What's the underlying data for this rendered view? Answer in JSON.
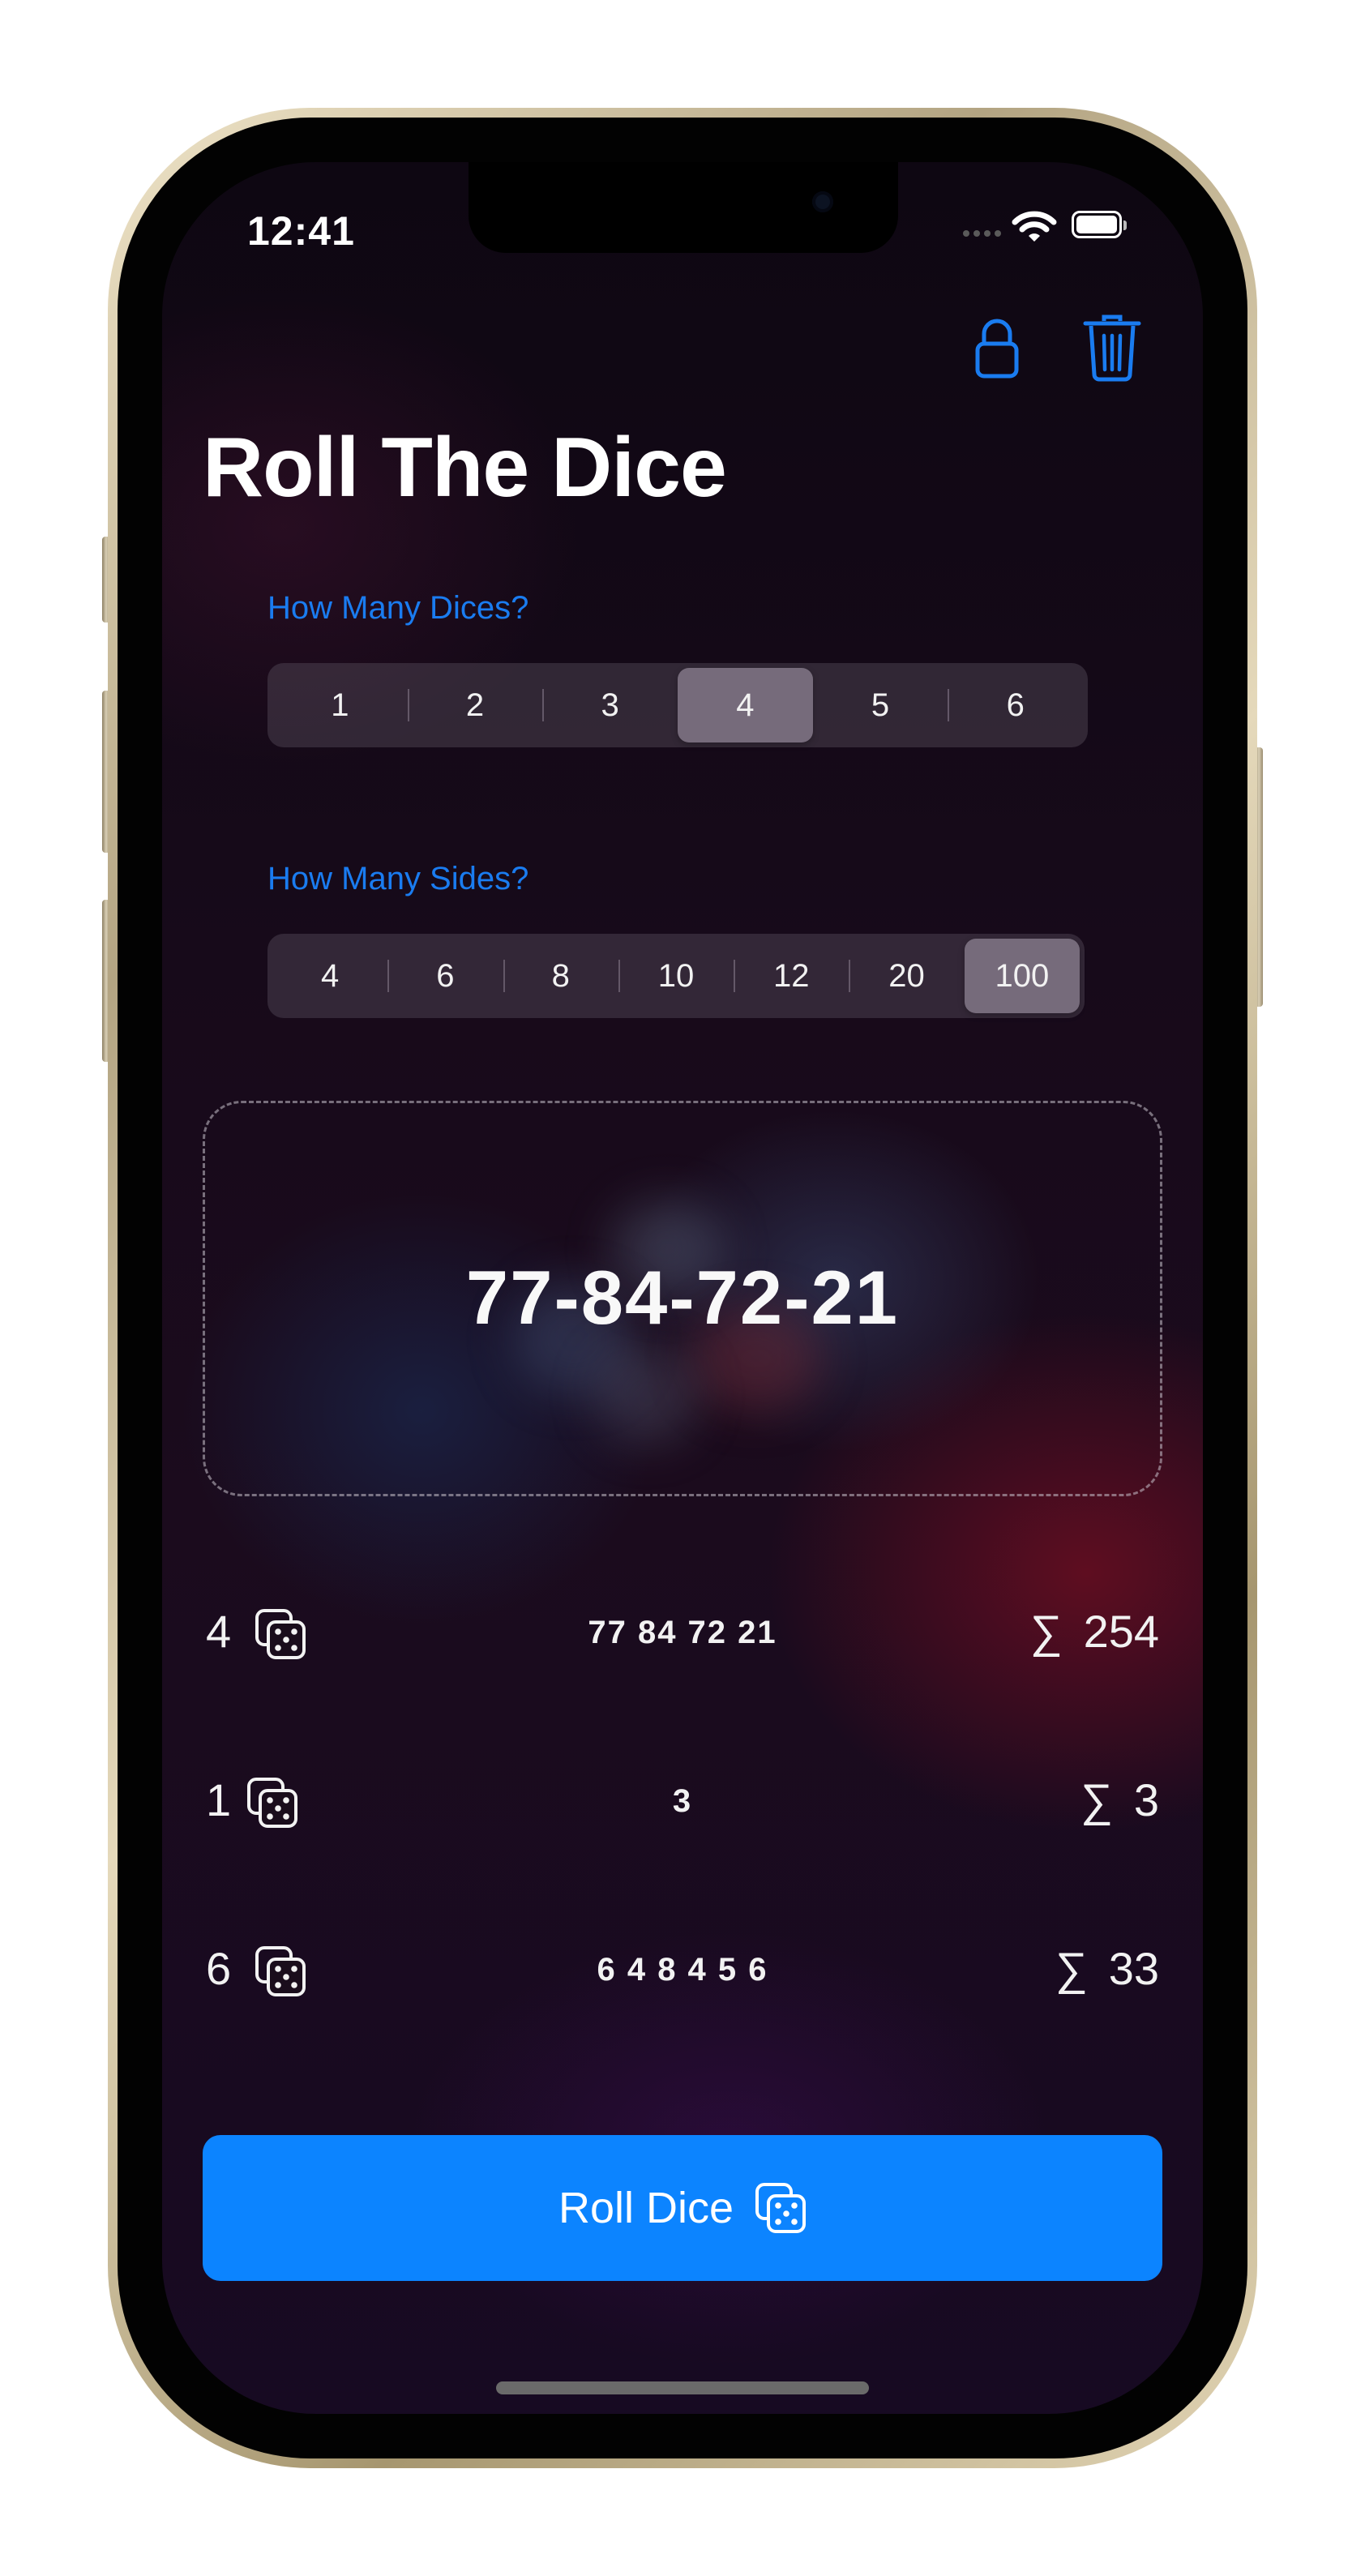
{
  "status_bar": {
    "time": "12:41"
  },
  "toolbar": {
    "lock_icon": "lock-icon",
    "trash_icon": "trash-icon"
  },
  "title": "Roll The Dice",
  "dice_picker": {
    "label": "How Many Dices?",
    "options": [
      "1",
      "2",
      "3",
      "4",
      "5",
      "6"
    ],
    "selected": "4"
  },
  "sides_picker": {
    "label": "How Many Sides?",
    "options": [
      "4",
      "6",
      "8",
      "10",
      "12",
      "20",
      "100"
    ],
    "selected": "100"
  },
  "result": "77-84-72-21",
  "history": [
    {
      "count": "4",
      "values": "77 84 72 21",
      "sigma": "∑",
      "sum": "254"
    },
    {
      "count": "1",
      "values": "3",
      "sigma": "∑",
      "sum": "3"
    },
    {
      "count": "6",
      "values": "6 4 8 4 5 6",
      "sigma": "∑",
      "sum": "33"
    }
  ],
  "roll_button": {
    "label": "Roll Dice",
    "icon": "dice-icon"
  },
  "colors": {
    "accent": "#0c84ff",
    "label_blue": "#1a7cf0"
  }
}
